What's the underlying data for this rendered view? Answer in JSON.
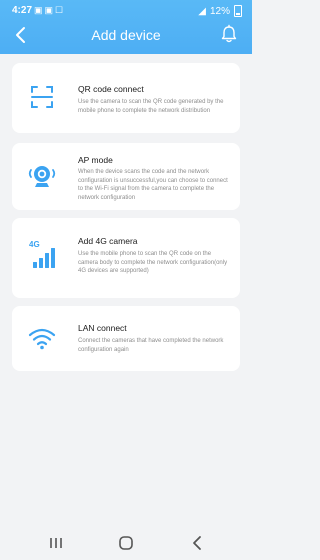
{
  "status_bar": {
    "time": "4:27",
    "battery": "12%"
  },
  "header": {
    "title": "Add device",
    "back_icon": "chevron-left-icon",
    "action_icon": "bell-icon"
  },
  "options": [
    {
      "title": "QR code connect",
      "description": "Use the camera to scan the QR code generated by the mobile phone to complete the network distribution",
      "icon": "qr-scan-icon"
    },
    {
      "title": "AP mode",
      "description": "When the device scans the code and the network configuration is unsuccessful,you can choose to connect to the Wi-Fi signal from the camera to complete the network configuration",
      "icon": "webcam-icon"
    },
    {
      "title": "Add 4G camera",
      "description": "Use the mobile phone to scan the QR code on the camera body to complete the network configuration(only 4G devices are supported)",
      "icon": "4g-signal-icon",
      "icon_label": "4G"
    },
    {
      "title": "LAN connect",
      "description": "Connect the cameras that have completed the network configuration again",
      "icon": "wifi-icon"
    }
  ],
  "colors": {
    "accent": "#4daef4",
    "background": "#f2f3f5"
  }
}
